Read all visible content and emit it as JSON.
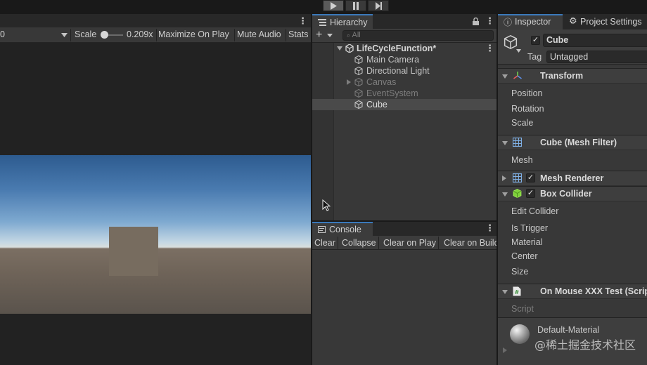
{
  "toolbar": {
    "play_icon": "play-icon",
    "pause_icon": "pause-icon",
    "step_icon": "step-icon"
  },
  "game_view": {
    "display_value": "0",
    "scale_label": "Scale",
    "scale_value": "0.209",
    "scale_suffix": "x",
    "maximize_label": "Maximize On Play",
    "mute_label": "Mute Audio",
    "stats_label": "Stats"
  },
  "hierarchy": {
    "tab_label": "Hierarchy",
    "search_placeholder": "All",
    "scene_name": "LifeCycleFunction*",
    "items": [
      {
        "label": "Main Camera",
        "dimmed": false,
        "selected": false,
        "expandable": false
      },
      {
        "label": "Directional Light",
        "dimmed": false,
        "selected": false,
        "expandable": false
      },
      {
        "label": "Canvas",
        "dimmed": true,
        "selected": false,
        "expandable": true
      },
      {
        "label": "EventSystem",
        "dimmed": true,
        "selected": false,
        "expandable": false
      },
      {
        "label": "Cube",
        "dimmed": false,
        "selected": true,
        "expandable": false
      }
    ]
  },
  "console": {
    "tab_label": "Console",
    "buttons": [
      "Clear",
      "Collapse",
      "Clear on Play",
      "Clear on Build"
    ]
  },
  "inspector": {
    "tab_label": "Inspector",
    "settings_tab_label": "Project Settings",
    "object_name": "Cube",
    "tag_label": "Tag",
    "tag_value": "Untagged",
    "components": {
      "transform": {
        "title": "Transform",
        "props": [
          "Position",
          "Rotation",
          "Scale"
        ]
      },
      "mesh_filter": {
        "title": "Cube (Mesh Filter)",
        "props": [
          "Mesh"
        ]
      },
      "mesh_renderer": {
        "title": "Mesh Renderer"
      },
      "box_collider": {
        "title": "Box Collider",
        "props": [
          "Edit Collider",
          "Is Trigger",
          "Material",
          "Center",
          "Size"
        ]
      },
      "script": {
        "title": "On Mouse XXX Test (Script)",
        "props": [
          "Script"
        ]
      }
    },
    "material_name": "Default-Material"
  },
  "watermark": "@稀土掘金技术社区",
  "colors": {
    "selection_tab_accent": "#3a79bb",
    "panel_bg": "#383838",
    "sky_top": "#2d5b8f",
    "ground": "#6e6358",
    "cube": "#776c5f"
  }
}
